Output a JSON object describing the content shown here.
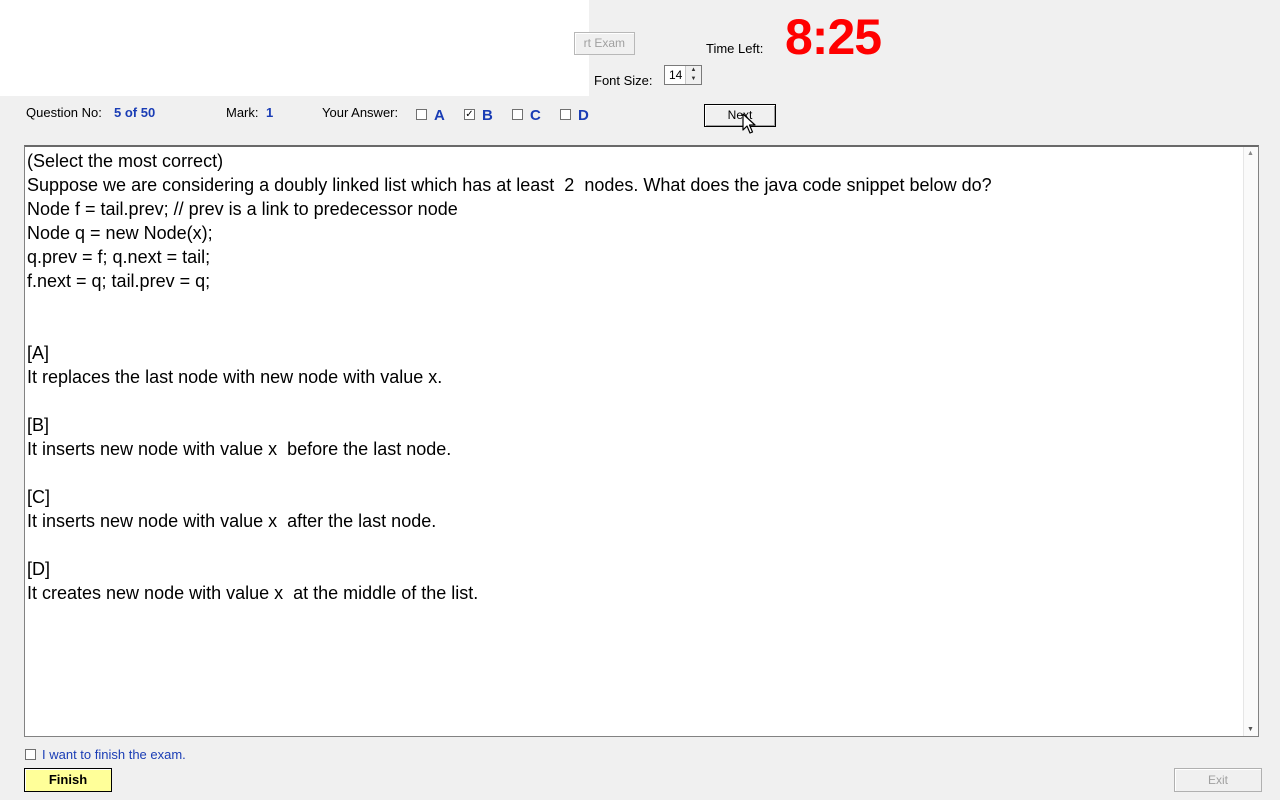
{
  "toolbar": {
    "start_exam_label": "rt Exam",
    "time_left_label": "Time Left:",
    "timer": "8:25",
    "font_size_label": "Font Size:",
    "font_size_value": "14",
    "next_label": "Next"
  },
  "status": {
    "question_no_label": "Question No:",
    "question_no_value": "5 of 50",
    "mark_label": "Mark:",
    "mark_value": "1",
    "your_answer_label": "Your Answer:"
  },
  "answers": [
    {
      "letter": "A",
      "checked": false
    },
    {
      "letter": "B",
      "checked": true
    },
    {
      "letter": "C",
      "checked": false
    },
    {
      "letter": "D",
      "checked": false
    }
  ],
  "question": {
    "text": "(Select the most correct)\nSuppose we are considering a doubly linked list which has at least  2  nodes. What does the java code snippet below do?\nNode f = tail.prev; // prev is a link to predecessor node\nNode q = new Node(x);\nq.prev = f; q.next = tail;\nf.next = q; tail.prev = q;\n\n\n[A]\nIt replaces the last node with new node with value x.\n\n[B]\nIt inserts new node with value x  before the last node.\n\n[C]\nIt inserts new node with value x  after the last node.\n\n[D]\nIt creates new node with value x  at the middle of the list."
  },
  "footer": {
    "finish_check_label": "I want to finish the exam.",
    "finish_checked": false,
    "finish_label": "Finish",
    "exit_label": "Exit"
  },
  "colors": {
    "timer": "#ff0000",
    "accent_blue": "#1a3db5",
    "finish_button_bg": "#ffff99"
  },
  "icons": {
    "cursor": "mouse-pointer-icon",
    "spin_up": "triangle-up",
    "spin_down": "triangle-down",
    "scroll_up": "triangle-up",
    "scroll_down": "triangle-down"
  }
}
